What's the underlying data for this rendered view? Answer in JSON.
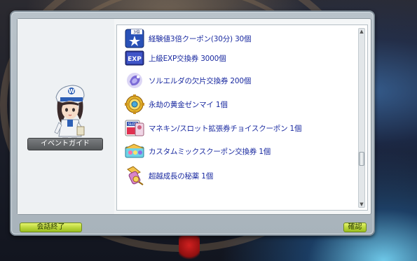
{
  "npc": {
    "name": "イベントガイド",
    "hat_letter": "W"
  },
  "rewards": [
    {
      "icon": "exp-coupon-icon",
      "badge": "3倍",
      "label": "経験値3倍クーポン(30分) 30個"
    },
    {
      "icon": "exp-ticket-icon",
      "badge": "EXP",
      "label": "上級EXP交換券 3000個"
    },
    {
      "icon": "sol-erda-fragment-icon",
      "label": "ソルエルダの欠片交換券 200個"
    },
    {
      "icon": "golden-gear-icon",
      "label": "永劫の黄金ゼンマイ 1個"
    },
    {
      "icon": "mannequin-slot-coupon-icon",
      "badge": "SLOT",
      "label": "マネキン/スロット拡張券チョイスクーポン 1個"
    },
    {
      "icon": "custom-mix-coupon-icon",
      "label": "カスタムミックスクーポン交換券 1個"
    },
    {
      "icon": "growth-elixir-icon",
      "label": "超越成長の秘薬 1個"
    }
  ],
  "buttons": {
    "end_chat": "会話終了",
    "confirm": "確認"
  },
  "colors": {
    "item_text": "#1a2aa0",
    "button_green": "#b9d53a",
    "npc_tag": "#545759"
  }
}
